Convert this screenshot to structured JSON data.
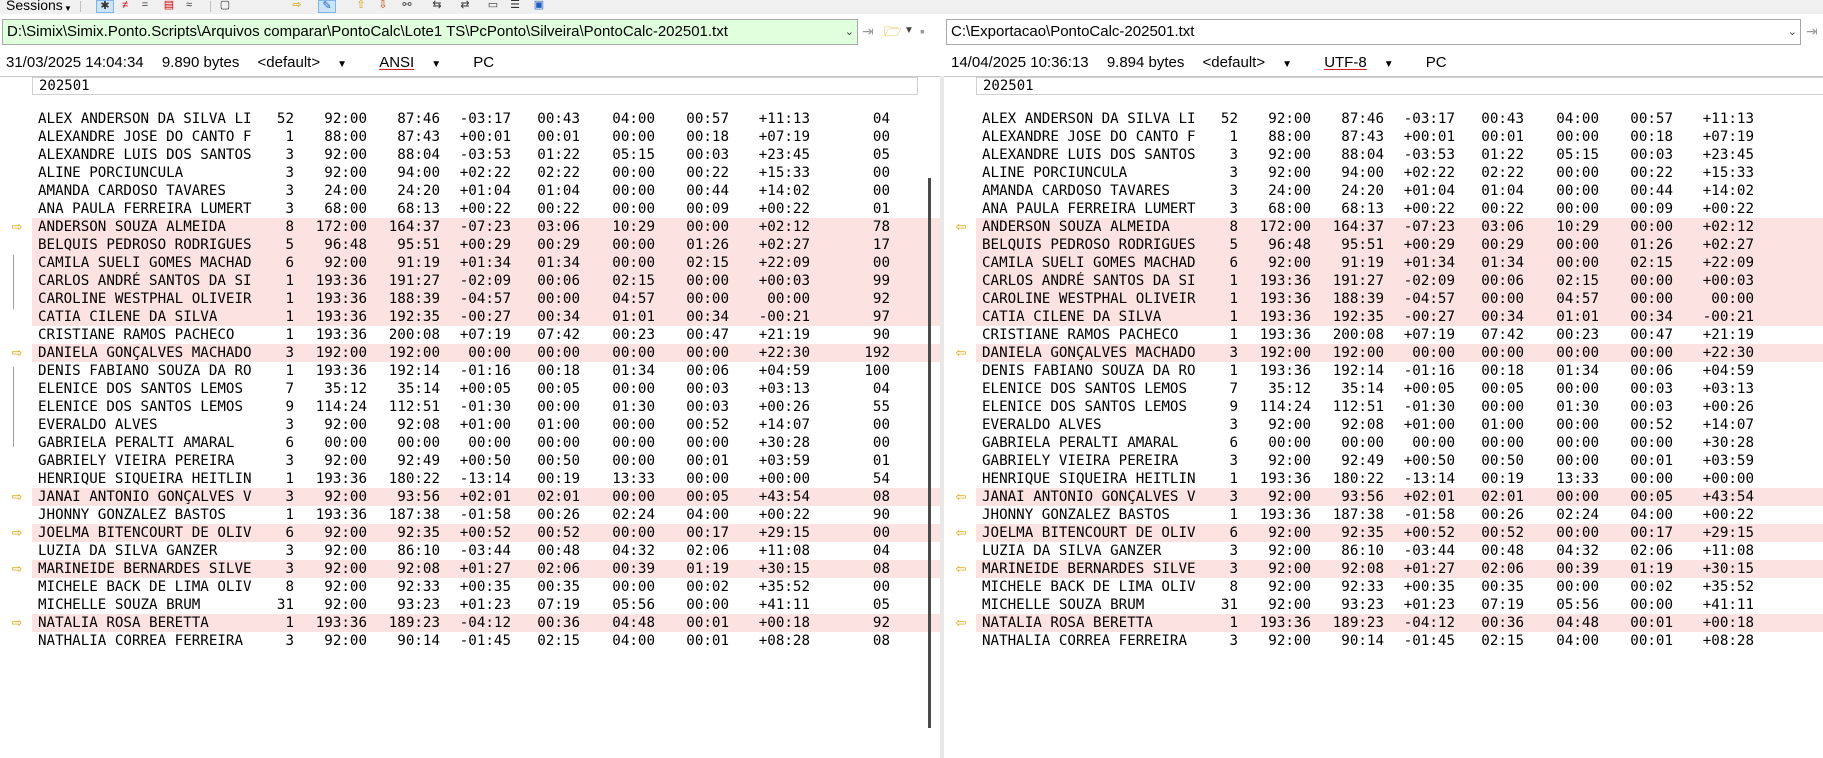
{
  "toolbar": {
    "sessions_label": "Sessions",
    "icons": [
      "pin-icon",
      "red-not-equal-icon",
      "equal-icon",
      "filter-icon",
      "approx-icon",
      "arrow-right-icon",
      "pencil-icon",
      "up-arrow-icon",
      "down-arrow-icon",
      "binoculars-icon",
      "swap-icon",
      "document-icon",
      "list-icon",
      "export-icon"
    ]
  },
  "left": {
    "path": "D:\\Simix\\Simix.Ponto.Scripts\\Arquivos comparar\\PontoCalc\\Lote1 TS\\PcPonto\\Silveira\\PontoCalc-202501.txt",
    "timestamp": "31/03/2025 14:04:34",
    "size": "9.890 bytes",
    "profile": "<default>",
    "encoding": "ANSI",
    "lineend": "PC",
    "header": "202501"
  },
  "right": {
    "path": "C:\\Exportacao\\PontoCalc-202501.txt",
    "timestamp": "14/04/2025 10:36:13",
    "size": "9.894 bytes",
    "profile": "<default>",
    "encoding": "UTF-8",
    "lineend": "PC",
    "header": "202501"
  },
  "rows": [
    {
      "name": "ALEX ANDERSON DA SILVA LI",
      "n": "52",
      "a": "92:00",
      "b": "87:46",
      "c": "-03:17",
      "d": "00:43",
      "e": "04:00",
      "f": "00:57",
      "g": "+11:13",
      "hl": "04",
      "hr": "",
      "diff": false
    },
    {
      "name": "ALEXANDRE JOSE DO CANTO F",
      "n": "1",
      "a": "88:00",
      "b": "87:43",
      "c": "+00:01",
      "d": "00:01",
      "e": "00:00",
      "f": "00:18",
      "g": "+07:19",
      "hl": "00",
      "hr": "",
      "diff": false
    },
    {
      "name": "ALEXANDRE LUIS DOS SANTOS",
      "n": "3",
      "a": "92:00",
      "b": "88:04",
      "c": "-03:53",
      "d": "01:22",
      "e": "05:15",
      "f": "00:03",
      "g": "+23:45",
      "hl": "05",
      "hr": "",
      "diff": false
    },
    {
      "name": "ALINE PORCIUNCULA",
      "n": "3",
      "a": "92:00",
      "b": "94:00",
      "c": "+02:22",
      "d": "02:22",
      "e": "00:00",
      "f": "00:22",
      "g": "+15:33",
      "hl": "00",
      "hr": "",
      "diff": false
    },
    {
      "name": "AMANDA CARDOSO TAVARES",
      "n": "3",
      "a": "24:00",
      "b": "24:20",
      "c": "+01:04",
      "d": "01:04",
      "e": "00:00",
      "f": "00:44",
      "g": "+14:02",
      "hl": "00",
      "hr": "",
      "diff": false
    },
    {
      "name": "ANA PAULA FERREIRA LUMERT",
      "n": "3",
      "a": "68:00",
      "b": "68:13",
      "c": "+00:22",
      "d": "00:22",
      "e": "00:00",
      "f": "00:09",
      "g": "+00:22",
      "hl": "01",
      "hr": "",
      "diff": false
    },
    {
      "name": "ANDERSON SOUZA ALMEIDA",
      "n": "8",
      "a": "172:00",
      "b": "164:37",
      "c": "-07:23",
      "d": "03:06",
      "e": "10:29",
      "f": "00:00",
      "g": "+02:12",
      "hl": "78",
      "hr": "",
      "diff": true,
      "marker": true
    },
    {
      "name": "BELQUIS PEDROSO RODRIGUES",
      "n": "5",
      "a": "96:48",
      "b": "95:51",
      "c": "+00:29",
      "d": "00:29",
      "e": "00:00",
      "f": "01:26",
      "g": "+02:27",
      "hl": "17",
      "hr": "",
      "diff": true
    },
    {
      "name": "CAMILA SUELI GOMES MACHAD",
      "n": "6",
      "a": "92:00",
      "b": "91:19",
      "c": "+01:34",
      "d": "01:34",
      "e": "00:00",
      "f": "02:15",
      "g": "+22:09",
      "hl": "00",
      "hr": "",
      "diff": true
    },
    {
      "name": "CARLOS ANDRÉ SANTOS DA SI",
      "n": "1",
      "a": "193:36",
      "b": "191:27",
      "c": "-02:09",
      "d": "00:06",
      "e": "02:15",
      "f": "00:00",
      "g": "+00:03",
      "hl": "99",
      "hr": "",
      "diff": true
    },
    {
      "name": "CAROLINE WESTPHAL OLIVEIR",
      "n": "1",
      "a": "193:36",
      "b": "188:39",
      "c": "-04:57",
      "d": "00:00",
      "e": "04:57",
      "f": "00:00",
      "g": "00:00",
      "hl": "92",
      "hr": "",
      "diff": true
    },
    {
      "name": "CATIA CILENE DA SILVA",
      "n": "1",
      "a": "193:36",
      "b": "192:35",
      "c": "-00:27",
      "d": "00:34",
      "e": "01:01",
      "f": "00:34",
      "g": "-00:21",
      "hl": "97",
      "hr": "",
      "diff": true
    },
    {
      "name": "CRISTIANE RAMOS PACHECO",
      "n": "1",
      "a": "193:36",
      "b": "200:08",
      "c": "+07:19",
      "d": "07:42",
      "e": "00:23",
      "f": "00:47",
      "g": "+21:19",
      "hl": "90",
      "hr": "",
      "diff": false
    },
    {
      "name": "DANIELA GONÇALVES MACHADO",
      "n": "3",
      "a": "192:00",
      "b": "192:00",
      "c": "00:00",
      "d": "00:00",
      "e": "00:00",
      "f": "00:00",
      "g": "+22:30",
      "hl": "192",
      "hr": "",
      "diff": true,
      "marker": true
    },
    {
      "name": "DENIS FABIANO SOUZA DA RO",
      "n": "1",
      "a": "193:36",
      "b": "192:14",
      "c": "-01:16",
      "d": "00:18",
      "e": "01:34",
      "f": "00:06",
      "g": "+04:59",
      "hl": "100",
      "hr": "",
      "diff": false
    },
    {
      "name": "ELENICE DOS SANTOS LEMOS",
      "n": "7",
      "a": "35:12",
      "b": "35:14",
      "c": "+00:05",
      "d": "00:05",
      "e": "00:00",
      "f": "00:03",
      "g": "+03:13",
      "hl": "04",
      "hr": "",
      "diff": false
    },
    {
      "name": "ELENICE DOS SANTOS LEMOS",
      "n": "9",
      "a": "114:24",
      "b": "112:51",
      "c": "-01:30",
      "d": "00:00",
      "e": "01:30",
      "f": "00:03",
      "g": "+00:26",
      "hl": "55",
      "hr": "",
      "diff": false
    },
    {
      "name": "EVERALDO ALVES",
      "n": "3",
      "a": "92:00",
      "b": "92:08",
      "c": "+01:00",
      "d": "01:00",
      "e": "00:00",
      "f": "00:52",
      "g": "+14:07",
      "hl": "00",
      "hr": "",
      "diff": false
    },
    {
      "name": "GABRIELA PERALTI AMARAL",
      "n": "6",
      "a": "00:00",
      "b": "00:00",
      "c": "00:00",
      "d": "00:00",
      "e": "00:00",
      "f": "00:00",
      "g": "+30:28",
      "hl": "00",
      "hr": "",
      "diff": false
    },
    {
      "name": "GABRIELY VIEIRA PEREIRA",
      "n": "3",
      "a": "92:00",
      "b": "92:49",
      "c": "+00:50",
      "d": "00:50",
      "e": "00:00",
      "f": "00:01",
      "g": "+03:59",
      "hl": "01",
      "hr": "",
      "diff": false
    },
    {
      "name": "HENRIQUE SIQUEIRA HEITLIN",
      "n": "1",
      "a": "193:36",
      "b": "180:22",
      "c": "-13:14",
      "d": "00:19",
      "e": "13:33",
      "f": "00:00",
      "g": "+00:00",
      "hl": "54",
      "hr": "",
      "diff": false
    },
    {
      "name": "JANAI ANTONIO GONÇALVES V",
      "n": "3",
      "a": "92:00",
      "b": "93:56",
      "c": "+02:01",
      "d": "02:01",
      "e": "00:00",
      "f": "00:05",
      "g": "+43:54",
      "hl": "08",
      "hr": "",
      "diff": true,
      "marker": true
    },
    {
      "name": "JHONNY GONZALEZ BASTOS",
      "n": "1",
      "a": "193:36",
      "b": "187:38",
      "c": "-01:58",
      "d": "00:26",
      "e": "02:24",
      "f": "04:00",
      "g": "+00:22",
      "hl": "90",
      "hr": "",
      "diff": false
    },
    {
      "name": "JOELMA BITENCOURT DE OLIV",
      "n": "6",
      "a": "92:00",
      "b": "92:35",
      "c": "+00:52",
      "d": "00:52",
      "e": "00:00",
      "f": "00:17",
      "g": "+29:15",
      "hl": "00",
      "hr": "",
      "diff": true,
      "marker": true
    },
    {
      "name": "LUZIA DA SILVA GANZER",
      "n": "3",
      "a": "92:00",
      "b": "86:10",
      "c": "-03:44",
      "d": "00:48",
      "e": "04:32",
      "f": "02:06",
      "g": "+11:08",
      "hl": "04",
      "hr": "",
      "diff": false
    },
    {
      "name": "MARINEIDE BERNARDES SILVE",
      "n": "3",
      "a": "92:00",
      "b": "92:08",
      "c": "+01:27",
      "d": "02:06",
      "e": "00:39",
      "f": "01:19",
      "g": "+30:15",
      "hl": "08",
      "hr": "",
      "diff": true,
      "marker": true
    },
    {
      "name": "MICHELE BACK DE LIMA OLIV",
      "n": "8",
      "a": "92:00",
      "b": "92:33",
      "c": "+00:35",
      "d": "00:35",
      "e": "00:00",
      "f": "00:02",
      "g": "+35:52",
      "hl": "00",
      "hr": "",
      "diff": false
    },
    {
      "name": "MICHELLE SOUZA BRUM",
      "n": "31",
      "a": "92:00",
      "b": "93:23",
      "c": "+01:23",
      "d": "07:19",
      "e": "05:56",
      "f": "00:00",
      "g": "+41:11",
      "hl": "05",
      "hr": "",
      "diff": false
    },
    {
      "name": "NATALIA ROSA BERETTA",
      "n": "1",
      "a": "193:36",
      "b": "189:23",
      "c": "-04:12",
      "d": "00:36",
      "e": "04:48",
      "f": "00:01",
      "g": "+00:18",
      "hl": "92",
      "hr": "",
      "diff": true,
      "marker": true
    },
    {
      "name": "NATHALIA CORREA FERREIRA",
      "n": "3",
      "a": "92:00",
      "b": "90:14",
      "c": "-01:45",
      "d": "02:15",
      "e": "04:00",
      "f": "00:01",
      "g": "+08:28",
      "hl": "08",
      "hr": "",
      "diff": false
    }
  ]
}
